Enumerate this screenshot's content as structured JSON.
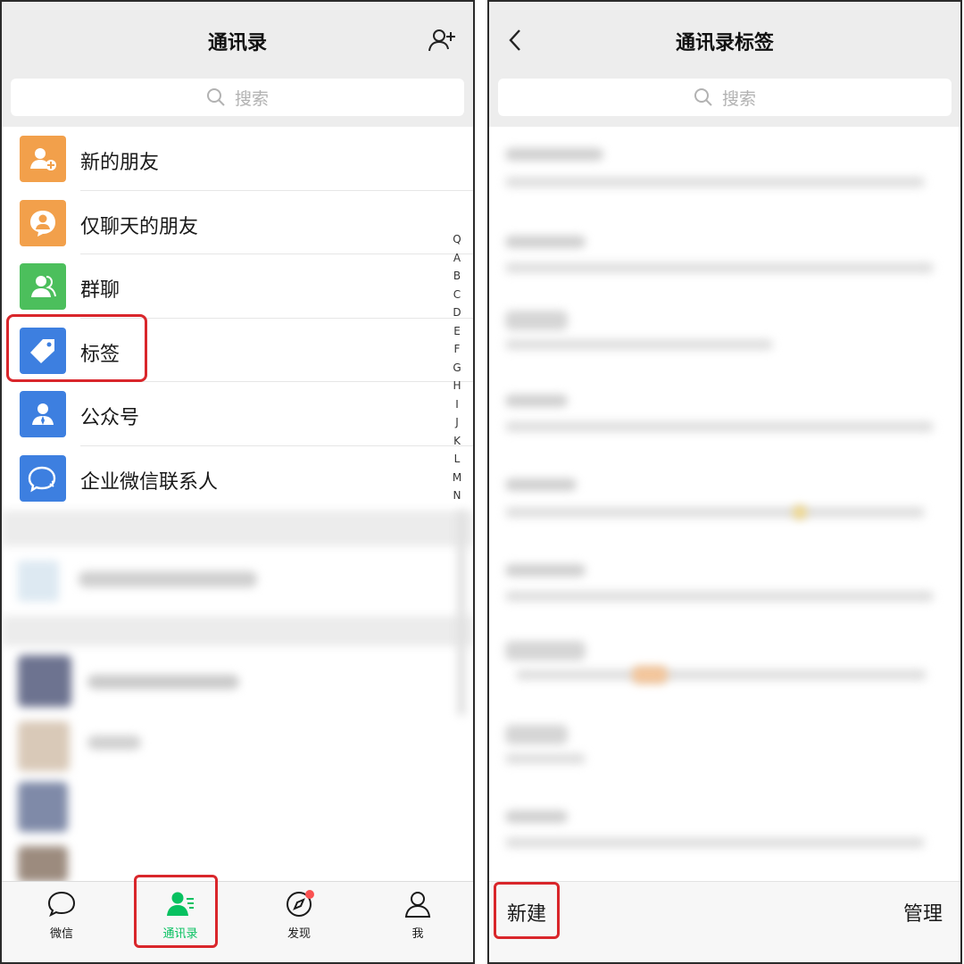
{
  "left": {
    "title": "通讯录",
    "search_placeholder": "搜索",
    "menu": [
      {
        "label": "新的朋友",
        "color": "#f2a04b"
      },
      {
        "label": "仅聊天的朋友",
        "color": "#f2a04b"
      },
      {
        "label": "群聊",
        "color": "#4cbf5c"
      },
      {
        "label": "标签",
        "color": "#3d7fe0"
      },
      {
        "label": "公众号",
        "color": "#3d7fe0"
      },
      {
        "label": "企业微信联系人",
        "color": "#3d7fe0"
      }
    ],
    "alpha_index": [
      "Q",
      "A",
      "B",
      "C",
      "D",
      "E",
      "F",
      "G",
      "H",
      "I",
      "J",
      "K",
      "L",
      "M",
      "N"
    ],
    "tabs": [
      {
        "label": "微信"
      },
      {
        "label": "通讯录"
      },
      {
        "label": "发现"
      },
      {
        "label": "我"
      }
    ],
    "accent": "#07c160",
    "highlight": "#d9262b"
  },
  "right": {
    "title": "通讯录标签",
    "search_placeholder": "搜索",
    "new_label": "新建",
    "manage_label": "管理"
  }
}
